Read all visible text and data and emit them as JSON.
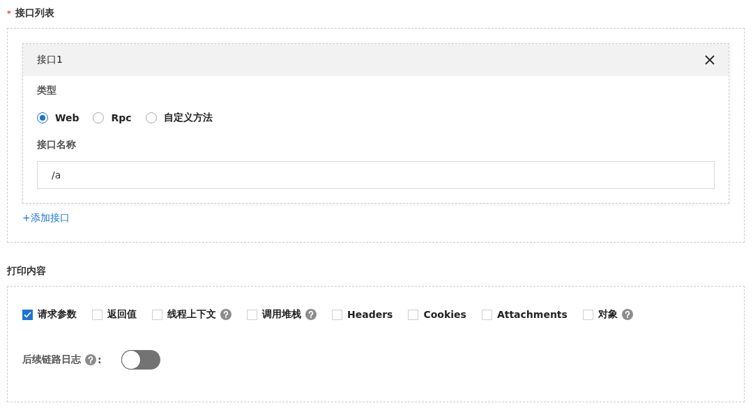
{
  "interface_list": {
    "title": "接口列表",
    "required_mark": "*",
    "interfaces": [
      {
        "title": "接口1",
        "type_label": "类型",
        "types": [
          {
            "label": "Web",
            "selected": true
          },
          {
            "label": "Rpc",
            "selected": false
          },
          {
            "label": "自定义方法",
            "selected": false
          }
        ],
        "name_label": "接口名称",
        "name_value": "/a"
      }
    ],
    "add_link": "+添加接口"
  },
  "print_content": {
    "title": "打印内容",
    "options": [
      {
        "label": "请求参数",
        "checked": true,
        "help": false
      },
      {
        "label": "返回值",
        "checked": false,
        "help": false
      },
      {
        "label": "线程上下文",
        "checked": false,
        "help": true
      },
      {
        "label": "调用堆栈",
        "checked": false,
        "help": true
      },
      {
        "label": "Headers",
        "checked": false,
        "help": false
      },
      {
        "label": "Cookies",
        "checked": false,
        "help": false
      },
      {
        "label": "Attachments",
        "checked": false,
        "help": false
      },
      {
        "label": "对象",
        "checked": false,
        "help": true
      }
    ],
    "followup_log": {
      "label": "后续链路日志",
      "help": true,
      "colon": ":",
      "on": false
    }
  }
}
